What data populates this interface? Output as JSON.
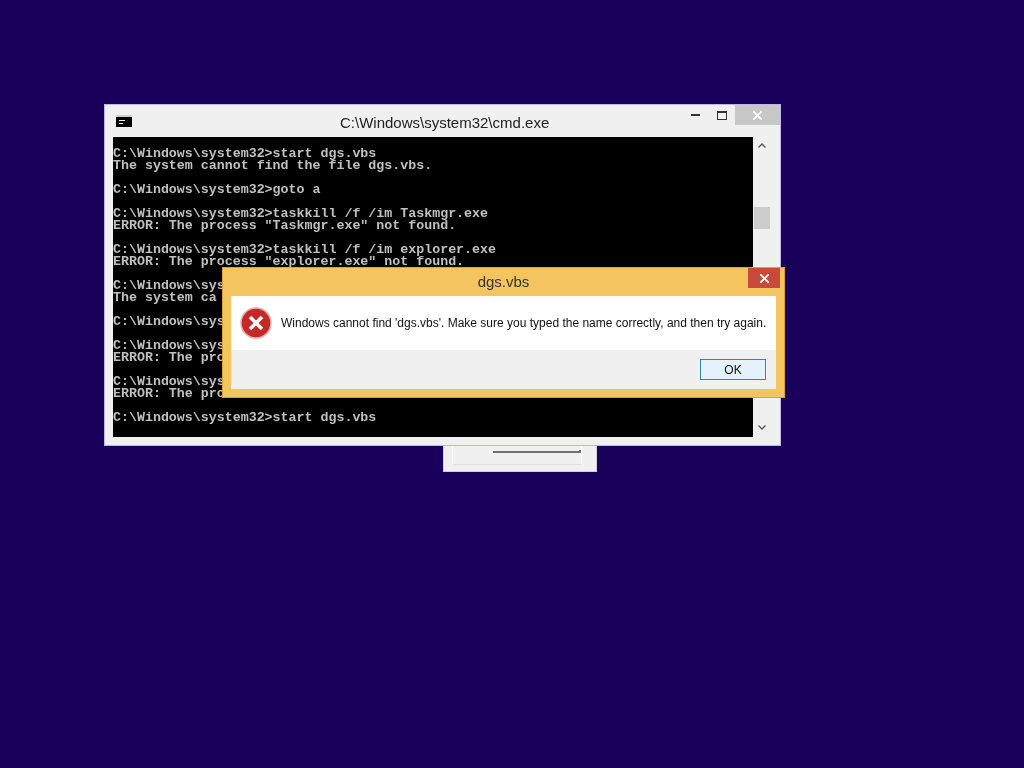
{
  "console_window": {
    "title": "C:\\Windows\\system32\\cmd.exe",
    "blocks": [
      [
        "C:\\Windows\\system32>start dgs.vbs",
        "The system cannot find the file dgs.vbs."
      ],
      [
        "C:\\Windows\\system32>goto a"
      ],
      [
        "C:\\Windows\\system32>taskkill /f /im Taskmgr.exe",
        "ERROR: The process \"Taskmgr.exe\" not found."
      ],
      [
        "C:\\Windows\\system32>taskkill /f /im explorer.exe",
        "ERROR: The process \"explorer.exe\" not found."
      ],
      [
        "C:\\Windows\\sys",
        "The system ca"
      ],
      [
        "C:\\Windows\\sys"
      ],
      [
        "C:\\Windows\\sys",
        "ERROR: The pro"
      ],
      [
        "C:\\Windows\\sys",
        "ERROR: The pro"
      ],
      [
        "C:\\Windows\\system32>start dgs.vbs"
      ]
    ]
  },
  "dialog": {
    "title": "dgs.vbs",
    "message": "Windows cannot find 'dgs.vbs'. Make sure you typed the name correctly, and then try again.",
    "button": "OK"
  }
}
